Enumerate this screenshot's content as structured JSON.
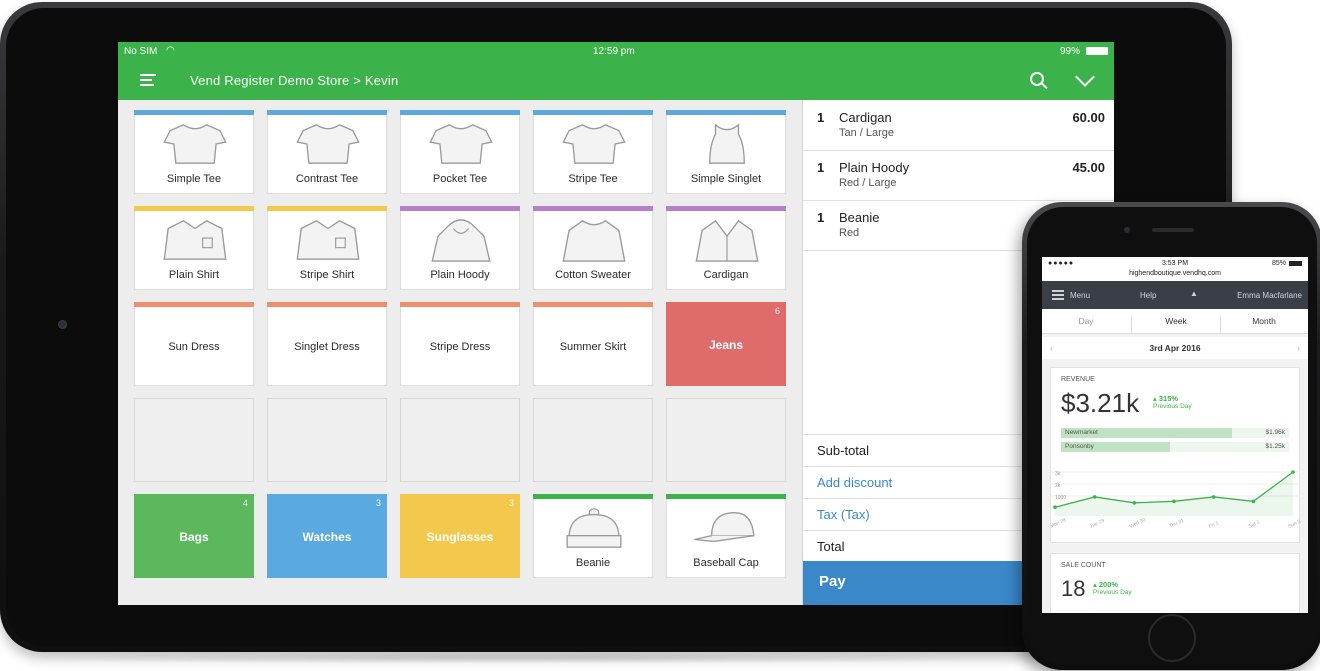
{
  "tablet": {
    "status": {
      "left": "No SIM",
      "time": "12:59 pm",
      "battery": "99%"
    },
    "appbar": {
      "title": "Vend Register Demo Store > Kevin"
    },
    "products": [
      {
        "label": "Simple Tee",
        "color": "#5aa9e0",
        "icon": "tshirt-icon"
      },
      {
        "label": "Contrast Tee",
        "color": "#5aa9e0",
        "icon": "tshirt-icon"
      },
      {
        "label": "Pocket Tee",
        "color": "#5aa9e0",
        "icon": "tshirt-icon"
      },
      {
        "label": "Stripe Tee",
        "color": "#5aa9e0",
        "icon": "tshirt-icon"
      },
      {
        "label": "Simple Singlet",
        "color": "#5aa9e0",
        "icon": "singlet-icon"
      },
      {
        "label": "Plain Shirt",
        "color": "#f2c94c",
        "icon": "shirt-icon"
      },
      {
        "label": "Stripe Shirt",
        "color": "#f2c94c",
        "icon": "shirt-icon"
      },
      {
        "label": "Plain Hoody",
        "color": "#b57fc9",
        "icon": "hoody-icon"
      },
      {
        "label": "Cotton Sweater",
        "color": "#b57fc9",
        "icon": "sweater-icon"
      },
      {
        "label": "Cardigan",
        "color": "#b57fc9",
        "icon": "cardigan-icon"
      },
      {
        "label": "Sun Dress",
        "color": "#ef8f6e"
      },
      {
        "label": "Singlet Dress",
        "color": "#ef8f6e"
      },
      {
        "label": "Stripe Dress",
        "color": "#ef8f6e"
      },
      {
        "label": "Summer Skirt",
        "color": "#ef8f6e"
      },
      {
        "label": "Jeans",
        "solid": "#e06b6b",
        "count": "6"
      },
      {},
      {},
      {},
      {},
      {},
      {
        "label": "Bags",
        "solid": "#5cb85c",
        "count": "4"
      },
      {
        "label": "Watches",
        "solid": "#5aa9e0",
        "count": "3"
      },
      {
        "label": "Sunglasses",
        "solid": "#f2c94c",
        "count": "3"
      },
      {
        "label": "Beanie",
        "color": "#3cb34a",
        "icon": "beanie-icon"
      },
      {
        "label": "Baseball Cap",
        "color": "#3cb34a",
        "icon": "cap-icon"
      }
    ],
    "cart": {
      "items": [
        {
          "qty": "1",
          "name": "Cardigan",
          "variant": "Tan / Large",
          "price": "60.00"
        },
        {
          "qty": "1",
          "name": "Plain Hoody",
          "variant": "Red / Large",
          "price": "45.00"
        },
        {
          "qty": "1",
          "name": "Beanie",
          "variant": "Red",
          "price": ""
        }
      ],
      "subtotal": "Sub-total",
      "discount": "Add discount",
      "tax": "Tax (Tax)",
      "total": "Total",
      "pay": "Pay"
    }
  },
  "phone": {
    "status": {
      "time": "3:53 PM",
      "url": "highendboutique.vendhq.com",
      "battery": "85%"
    },
    "nav": {
      "menu": "Menu",
      "help": "Help",
      "user": "Emma Macfarlane"
    },
    "tabs": [
      "Day",
      "Week",
      "Month"
    ],
    "date": "3rd Apr 2016",
    "revenue": {
      "label": "REVENUE",
      "value": "$3.21k",
      "change": "315%",
      "change_note": "Previous Day",
      "bars": [
        {
          "name": "Newmarket",
          "value": "$1.96k",
          "fraction": 0.75
        },
        {
          "name": "Ponsonby",
          "value": "$1.25k",
          "fraction": 0.48
        }
      ]
    },
    "chart_data": {
      "type": "line",
      "x": [
        "Mon 28",
        "Tue 29",
        "Wed 30",
        "Thu 31",
        "Fri 1",
        "Sat 2",
        "Sun 3"
      ],
      "yticks": [
        "3k",
        "2k",
        "1000"
      ],
      "series": [
        {
          "values": [
            600,
            1300,
            900,
            1000,
            1300,
            1000,
            3000
          ]
        }
      ],
      "ylim": [
        0,
        3000
      ]
    },
    "sale_count": {
      "label": "SALE COUNT",
      "value": "18",
      "change": "200%",
      "change_note": "Previous Day"
    }
  }
}
